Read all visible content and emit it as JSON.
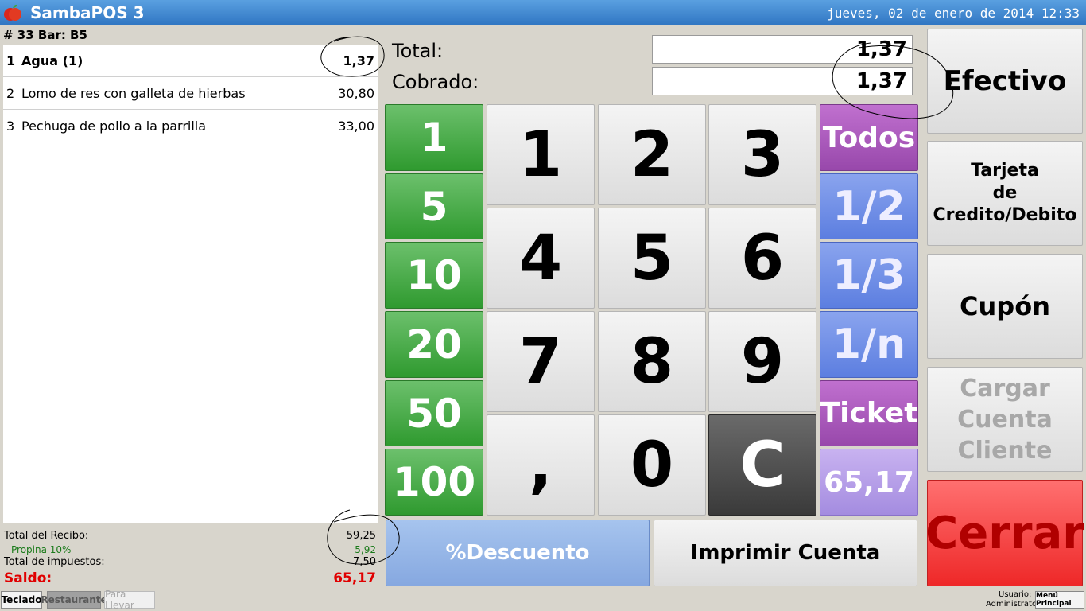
{
  "window": {
    "title": "SambaPOS 3",
    "datetime": "jueves, 02 de enero de 2014 12:33"
  },
  "ticket": {
    "header": "# 33 Bar: B5",
    "items": [
      {
        "qty": "1",
        "name": "Agua (1)",
        "price": "1,37",
        "selected": true
      },
      {
        "qty": "2",
        "name": "Lomo de res con galleta de hierbas",
        "price": "30,80",
        "selected": false
      },
      {
        "qty": "3",
        "name": "Pechuga de pollo a la parrilla",
        "price": "33,00",
        "selected": false
      }
    ],
    "totals": {
      "receipt_label": "Total del Recibo:",
      "receipt_value": "59,25",
      "tip_label": "Propina 10%",
      "tip_value": "5,92",
      "tax_label": "Total de impuestos:",
      "tax_value": "7,50",
      "balance_label": "Saldo:",
      "balance_value": "65,17"
    }
  },
  "payment": {
    "total_label": "Total:",
    "total_value": "1,37",
    "paid_label": "Cobrado:",
    "paid_value": "1,37"
  },
  "keypad": {
    "quick_amounts": [
      "1",
      "5",
      "10",
      "20",
      "50",
      "100"
    ],
    "digits": [
      "1",
      "2",
      "3",
      "4",
      "5",
      "6",
      "7",
      "8",
      "9",
      ",",
      "0"
    ],
    "clear": "C",
    "split_buttons": [
      "Todos",
      "1/2",
      "1/3",
      "1/n",
      "Ticket",
      "65,17"
    ]
  },
  "actions": {
    "discount": "%Descuento",
    "print_bill": "Imprimir Cuenta",
    "cash": "Efectivo",
    "card_line1": "Tarjeta",
    "card_line2": "de",
    "card_line3": "Credito/Debito",
    "coupon": "Cupón",
    "load_account_line1": "Cargar",
    "load_account_line2": "Cuenta",
    "load_account_line3": "Cliente",
    "close": "Cerrar"
  },
  "bottom_bar": {
    "tabs": [
      "Teclado",
      "Restaurante",
      "Para Llevar"
    ],
    "user_label": "Usuario:",
    "user_name": "Administrator",
    "main_menu": "Menú Principal"
  },
  "colors": {
    "titlebar": "#3b86d2",
    "quick_amount": "#3ea63e",
    "split_purple": "#a855bb",
    "split_blue": "#6b88e6",
    "close_red": "#f04040",
    "balance_red": "#e00000"
  }
}
